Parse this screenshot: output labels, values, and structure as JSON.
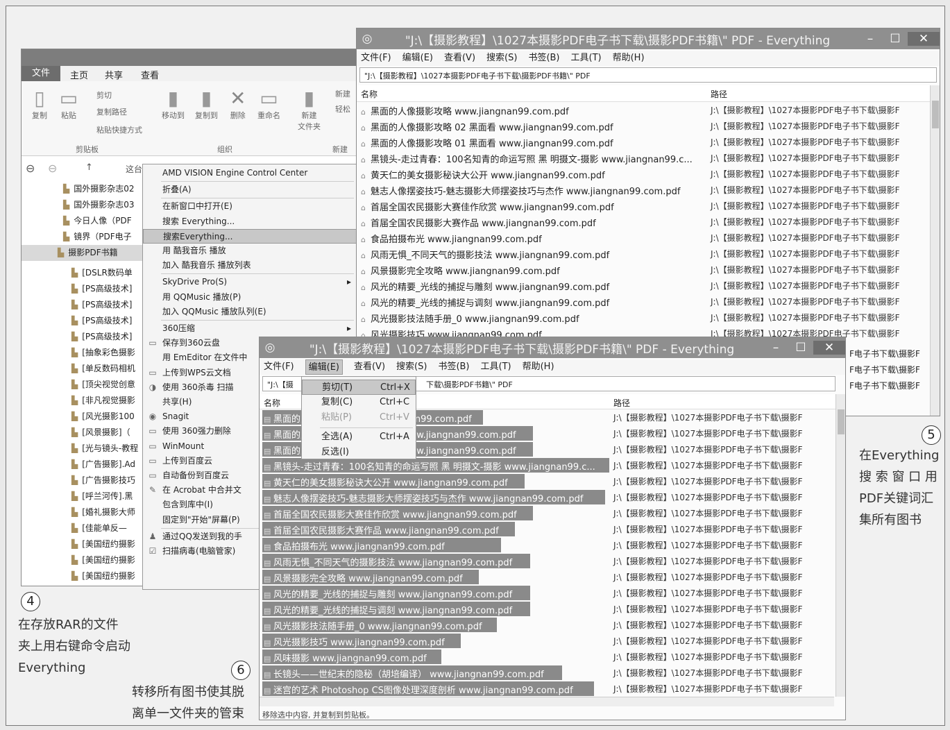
{
  "explorer": {
    "ribbon_tabs": [
      "文件",
      "主页",
      "共享",
      "查看"
    ],
    "ribbon_groups": [
      "剪贴板",
      "组织",
      "新建"
    ],
    "ribbon_buttons": {
      "copy": "复制",
      "paste": "粘贴",
      "cut": "剪切",
      "copy_path": "复制路径",
      "paste_shortcut": "粘贴快捷方式",
      "move_to": "移动到",
      "copy_to": "复制到",
      "delete": "删除",
      "rename": "重命名",
      "new_folder": "新建\n文件夹",
      "new_item": "新建",
      "easy_access": "轻松"
    },
    "breadcrumb": "这台",
    "tree_items": [
      "国外摄影杂志02",
      "国外摄影杂志03",
      "今日人像（PDF",
      "镜界（PDF电子",
      "摄影PDF书籍",
      "[DSLR数码单",
      "[PS高级技术]",
      "[PS高级技术]",
      "[PS高级技术]",
      "[PS高级技术]",
      "[抽象彩色摄影",
      "[单反数码相机",
      "[顶尖视觉创意",
      "[非凡视觉摄影",
      "[风光摄影100",
      "[风景摄影]（",
      "[光与镜头-教程",
      "[广告摄影].Ad",
      "[广告摄影技巧",
      "[呼兰河传].黑",
      "[婚礼摄影大师",
      "[佳能单反—",
      "[美国纽约摄影",
      "[美国纽约摄影",
      "[美国纽约摄影"
    ]
  },
  "context_menu": [
    "AMD VISION Engine Control Center",
    "折叠(A)",
    "在新窗口中打开(E)",
    "搜索 Everything...",
    "搜索Everything...",
    "用 酷我音乐 播放",
    "加入 酷我音乐 播放列表",
    "SkyDrive Pro(S)",
    "用 QQMusic 播放(P)",
    "加入 QQMusic 播放队列(E)",
    "360压缩",
    "保存到360云盘",
    "用 EmEditor 在文件中",
    "上传到WPS云文档",
    "使用 360杀毒 扫描",
    "共享(H)",
    "Snagit",
    "使用 360强力删除",
    "WinMount",
    "上传到百度云",
    "自动备份到百度云",
    "在 Acrobat 中合并文",
    "包含到库中(I)",
    "固定到\"开始\"屏幕(P)",
    "通过QQ发送到我的手",
    "扫描病毒(电脑管家)"
  ],
  "ev1": {
    "title": "\"J:\\【摄影教程】\\1027本摄影PDF电子书下载\\摄影PDF书籍\\\" PDF - Everything",
    "menu": [
      "文件(F)",
      "编辑(E)",
      "查看(V)",
      "搜索(S)",
      "书签(B)",
      "工具(T)",
      "帮助(H)"
    ],
    "search": "\"J:\\【摄影教程】\\1027本摄影PDF电子书下载\\摄影PDF书籍\\\" PDF",
    "col_name": "名称",
    "col_path": "路径",
    "path_value": "J:\\【摄影教程】\\1027本摄影PDF电子书下载\\摄影F",
    "rows": [
      "黑面的人像摄影攻略 www.jiangnan99.com.pdf",
      "黑面的人像摄影攻略 02 黑面看 www.jiangnan99.com.pdf",
      "黑面的人像摄影攻略 01 黑面看 www.jiangnan99.com.pdf",
      "黑镜头-走过青春：100名知青的命运写照 黑 明摄文-摄影 www.jiangnan99.c...",
      "黄天仁的美女摄影秘诀大公开 www.jiangnan99.com.pdf",
      "魅志人像摆姿技巧-魅志摄影大师摆姿技巧与杰作 www.jiangnan99.com.pdf",
      "首届全国农民摄影大赛佳作欣赏 www.jiangnan99.com.pdf",
      "首届全国农民摄影大赛作品 www.jiangnan99.com.pdf",
      "食品拍摄布光 www.jiangnan99.com.pdf",
      "风雨无惧_不同天气的摄影技法 www.jiangnan99.com.pdf",
      "风景摄影完全攻略 www.jiangnan99.com.pdf",
      "风光的精要_光线的捕捉与雕刻 www.jiangnan99.com.pdf",
      "风光的精要_光线的捕捉与调刻 www.jiangnan99.com.pdf",
      "风光摄影技法随手册_0 www.jiangnan99.com.pdf",
      "风光摄影技巧 www.jiangnan99.com.pdf"
    ],
    "path_tail": "F电子书下载\\摄影F"
  },
  "ev2": {
    "title": "\"J:\\【摄影教程】\\1027本摄影PDF电子书下载\\摄影PDF书籍\\\" PDF - Everything",
    "menu": [
      "文件(F)",
      "编辑(E)",
      "查看(V)",
      "搜索(S)",
      "书签(B)",
      "工具(T)",
      "帮助(H)"
    ],
    "search": "\"J:\\【摄",
    "search_tail": "下载\\摄影PDF书籍\\\" PDF",
    "col_name": "名称",
    "col_path": "路径",
    "path_value": "J:\\【摄影教程】\\1027本摄影PDF电子书下载\\摄影F",
    "rows": [
      "黑面的人像摄影攻略 www.jiangnan99.com.pdf",
      "黑面的人像摄影攻略 02 黑面看 www.jiangnan99.com.pdf",
      "黑面的人像摄影攻略 01 黑面看 www.jiangnan99.com.pdf",
      "黑镜头-走过青春：100名知青的命运写照 黑 明摄文-摄影 www.jiangnan99.c...",
      "黄天仁的美女摄影秘诀大公开 www.jiangnan99.com.pdf",
      "魅志人像摆姿技巧-魅志摄影大师摆姿技巧与杰作 www.jiangnan99.com.pdf",
      "首届全国农民摄影大赛佳作欣赏 www.jiangnan99.com.pdf",
      "首届全国农民摄影大赛作品 www.jiangnan99.com.pdf",
      "食品拍摄布光 www.jiangnan99.com.pdf",
      "风雨无惧_不同天气的摄影技法 www.jiangnan99.com.pdf",
      "风景摄影完全攻略 www.jiangnan99.com.pdf",
      "风光的精要_光线的捕捉与雕刻 www.jiangnan99.com.pdf",
      "风光的精要_光线的捕捉与调刻 www.jiangnan99.com.pdf",
      "风光摄影技法随手册_0 www.jiangnan99.com.pdf",
      "风光摄影技巧 www.jiangnan99.com.pdf",
      "风味摄影 www.jiangnan99.com.pdf",
      "长镜头——世纪末的隐秘（胡培编译） www.jiangnan99.com.pdf",
      "迷宫的艺术 Photoshop CS图像处理深度剖析 www.jiangnan99.com.pdf"
    ],
    "status": "移除选中内容, 并复制到剪贴板。",
    "edit_menu": [
      {
        "label": "剪切(T)",
        "key": "Ctrl+X"
      },
      {
        "label": "复制(C)",
        "key": "Ctrl+C"
      },
      {
        "label": "粘贴(P)",
        "key": "Ctrl+V"
      },
      {
        "label": "全选(A)",
        "key": "Ctrl+A"
      },
      {
        "label": "反选(I)",
        "key": ""
      }
    ]
  },
  "notes": {
    "n4_num": "4",
    "n4_lines": [
      "在存放RAR的文件",
      "夹上用右键命令启动",
      "Everything"
    ],
    "n5_num": "5",
    "n5_lines": [
      "在Everything",
      "搜 索 窗 口 用",
      "PDF关键词汇",
      "集所有图书"
    ],
    "n6_num": "6",
    "n6_lines": [
      "转移所有图书使其脱",
      "离单一文件夹的管束"
    ]
  }
}
